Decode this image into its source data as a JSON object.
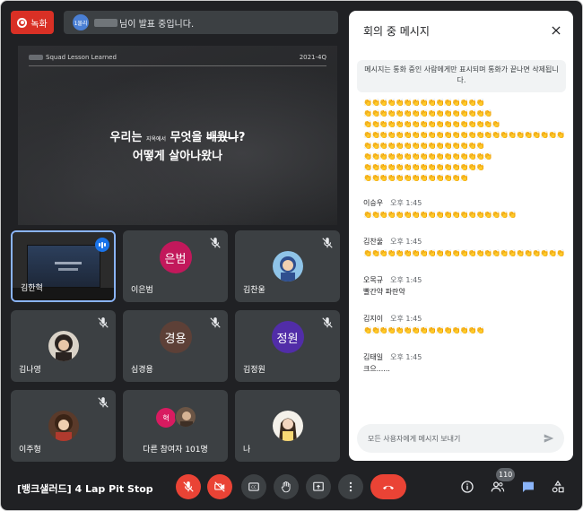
{
  "top": {
    "record_label": "녹화",
    "presenter_avatar_text": "1물리",
    "presenting_text": "님이 발표 중입니다."
  },
  "slide": {
    "header_left": "Squad Lesson Learned",
    "header_right": "2021-4Q",
    "line1_a": "우리는",
    "line1_small": "지옥에서",
    "line1_b": "무엇을",
    "line1_strike": "배웠나",
    "line1_end": "?",
    "line2": "어떻게 살아나왔나"
  },
  "tiles": [
    {
      "name": "김한혁"
    },
    {
      "name": "이은범",
      "avatar_text": "은범",
      "color": "#c2185b"
    },
    {
      "name": "김찬울"
    },
    {
      "name": "김나영"
    },
    {
      "name": "심경용",
      "avatar_text": "경용",
      "color": "#5d4037"
    },
    {
      "name": "김정원",
      "avatar_text": "정원",
      "color": "#512da8"
    },
    {
      "name": "이주형"
    },
    {
      "name": "다른 참여자 101명",
      "avatar_text": "혁",
      "color": "#d81b60"
    },
    {
      "name": "나"
    }
  ],
  "bottom": {
    "meeting_title": "[뱅크샐러드] 4 Lap Pit Stop",
    "participants_count": "110"
  },
  "chat": {
    "title": "회의 중 메시지",
    "notice": "메시지는 통화 중인 사람에게만 표시되며 통화가 끝나면 삭제됩니다.",
    "clap_lines": [
      "👏👏👏👏👏👏👏👏👏👏👏👏👏👏👏",
      "👏👏👏👏👏👏👏👏👏👏👏👏👏👏👏👏",
      "👏👏👏👏👏👏👏👏👏👏👏👏👏👏👏👏👏",
      "👏👏👏👏👏👏👏👏👏👏👏👏👏👏👏👏👏👏👏👏👏👏👏👏👏👏👏👏👏👏👏",
      "👏👏👏👏👏👏👏👏👏👏👏👏👏👏👏",
      "👏👏👏👏👏👏👏👏👏👏👏👏👏👏👏👏",
      "👏👏👏👏👏👏👏👏👏👏👏👏👏👏👏",
      "👏👏👏👏👏👏👏👏👏👏👏👏👏"
    ],
    "messages": [
      {
        "sender": "이승우",
        "time": "오후 1:45",
        "text": "👏👏👏👏👏👏👏👏👏👏👏👏👏👏👏👏👏👏👏"
      },
      {
        "sender": "김찬울",
        "time": "오후 1:45",
        "text": "👏👏👏👏👏👏👏👏👏👏👏👏👏👏👏👏👏👏👏👏👏👏👏👏👏👏👏👏👏👏👏👏👏👏👏👏👏"
      },
      {
        "sender": "오목규",
        "time": "오후 1:45",
        "text": "빨간약 파란약"
      },
      {
        "sender": "김지이",
        "time": "오후 1:45",
        "text": "👏👏👏👏👏👏👏👏👏👏👏👏👏👏👏"
      },
      {
        "sender": "김태일",
        "time": "오후 1:45",
        "text": "크으......"
      }
    ],
    "input_placeholder": "모든 사용자에게 메시지 보내기"
  },
  "colors": {
    "background": "#202124",
    "tile": "#3c4043",
    "red": "#ea4335",
    "accent_blue": "#1a73e8",
    "active_border": "#8ab4f8"
  }
}
